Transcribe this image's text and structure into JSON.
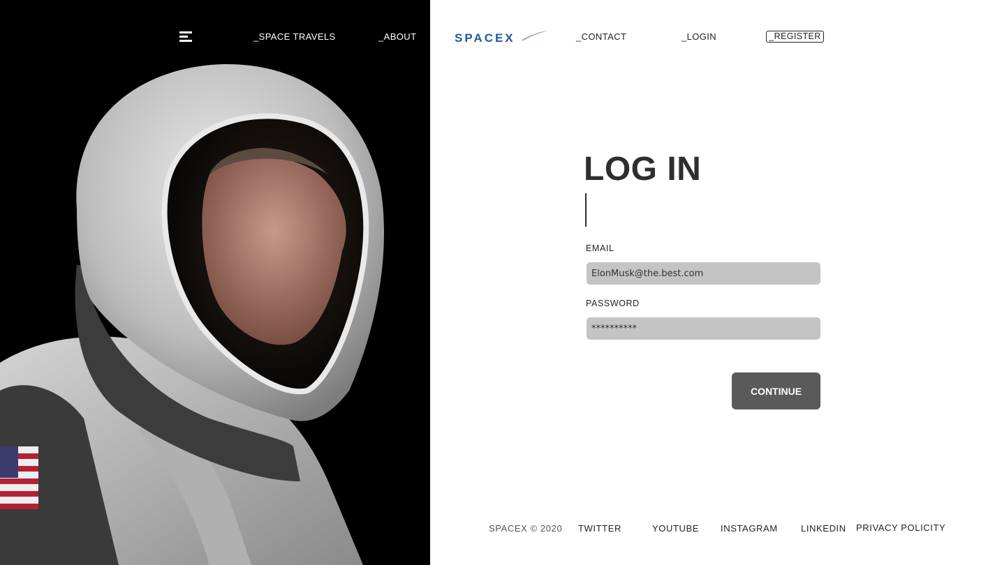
{
  "nav": {
    "menu_icon": "hamburger-menu-icon",
    "space_travels": "_SPACE TRAVELS",
    "about": "_ABOUT",
    "contact": "_CONTACT",
    "login": "_LOGIN",
    "register": "_REGISTER"
  },
  "brand": {
    "logo_text": "SPACEX",
    "logo_color": "#1f5aa0"
  },
  "form": {
    "title": "LOG IN",
    "email_label": "EMAIL",
    "email_value": "ElonMusk@the.best.com",
    "password_label": "PASSWORD",
    "password_value": "**********",
    "continue_label": "CONTINUE"
  },
  "footer": {
    "copyright": "SPACEX © 2020",
    "links": [
      "TWITTER",
      "YOUTUBE",
      "INSTAGRAM",
      "LINKEDIN",
      "PRIVACY POLICITY"
    ]
  },
  "colors": {
    "hero_background": "#000000",
    "input_background": "#c4c4c4",
    "button_background": "#5a5a5a",
    "text_dark": "#2e2e2e"
  }
}
